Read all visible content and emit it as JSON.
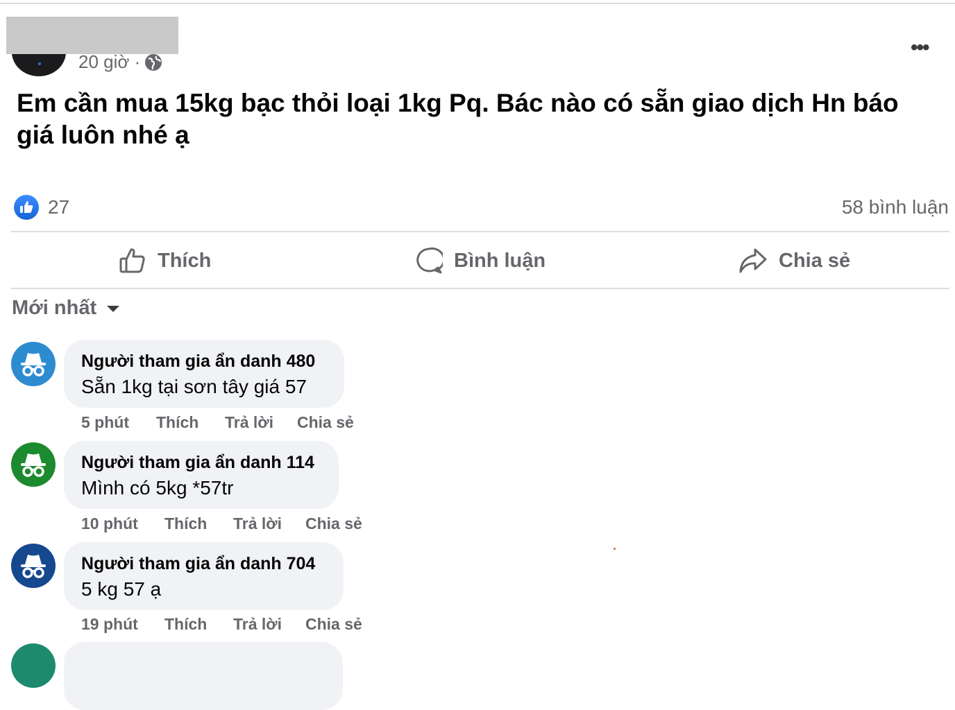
{
  "post": {
    "time": "20 giờ ·",
    "text": "Em cần mua 15kg bạc thỏi loại 1kg Pq. Bác nào có sẵn giao dịch Hn báo giá luôn nhé ạ",
    "like_count": "27",
    "comment_count": "58 bình luận",
    "more_icon": "ellipsis-icon",
    "privacy_icon": "globe-icon"
  },
  "actions": {
    "like": "Thích",
    "comment": "Bình luận",
    "share": "Chia sẻ"
  },
  "sort": {
    "label": "Mới nhất"
  },
  "colors": {
    "bubble": "#f0f2f5",
    "secondary_text": "#65676b",
    "like_blue": "#1877f2",
    "avatar_blue_light": "#2d8bd0",
    "avatar_green": "#1c8a2e",
    "avatar_navy": "#16488f",
    "avatar_teal": "#1d8a6e"
  },
  "comments": [
    {
      "author": "Người tham gia ẩn danh 480",
      "text": "Sẵn 1kg tại sơn tây giá 57",
      "time": "5 phút",
      "like": "Thích",
      "reply": "Trả lời",
      "share": "Chia sẻ"
    },
    {
      "author": "Người tham gia ẩn danh 114",
      "text": "Mình có 5kg *57tr",
      "time": "10 phút",
      "like": "Thích",
      "reply": "Trả lời",
      "share": "Chia sẻ"
    },
    {
      "author": "Người tham gia ẩn danh 704",
      "text": "5 kg 57 ạ",
      "time": "19 phút",
      "like": "Thích",
      "reply": "Trả lời",
      "share": "Chia sẻ"
    }
  ]
}
